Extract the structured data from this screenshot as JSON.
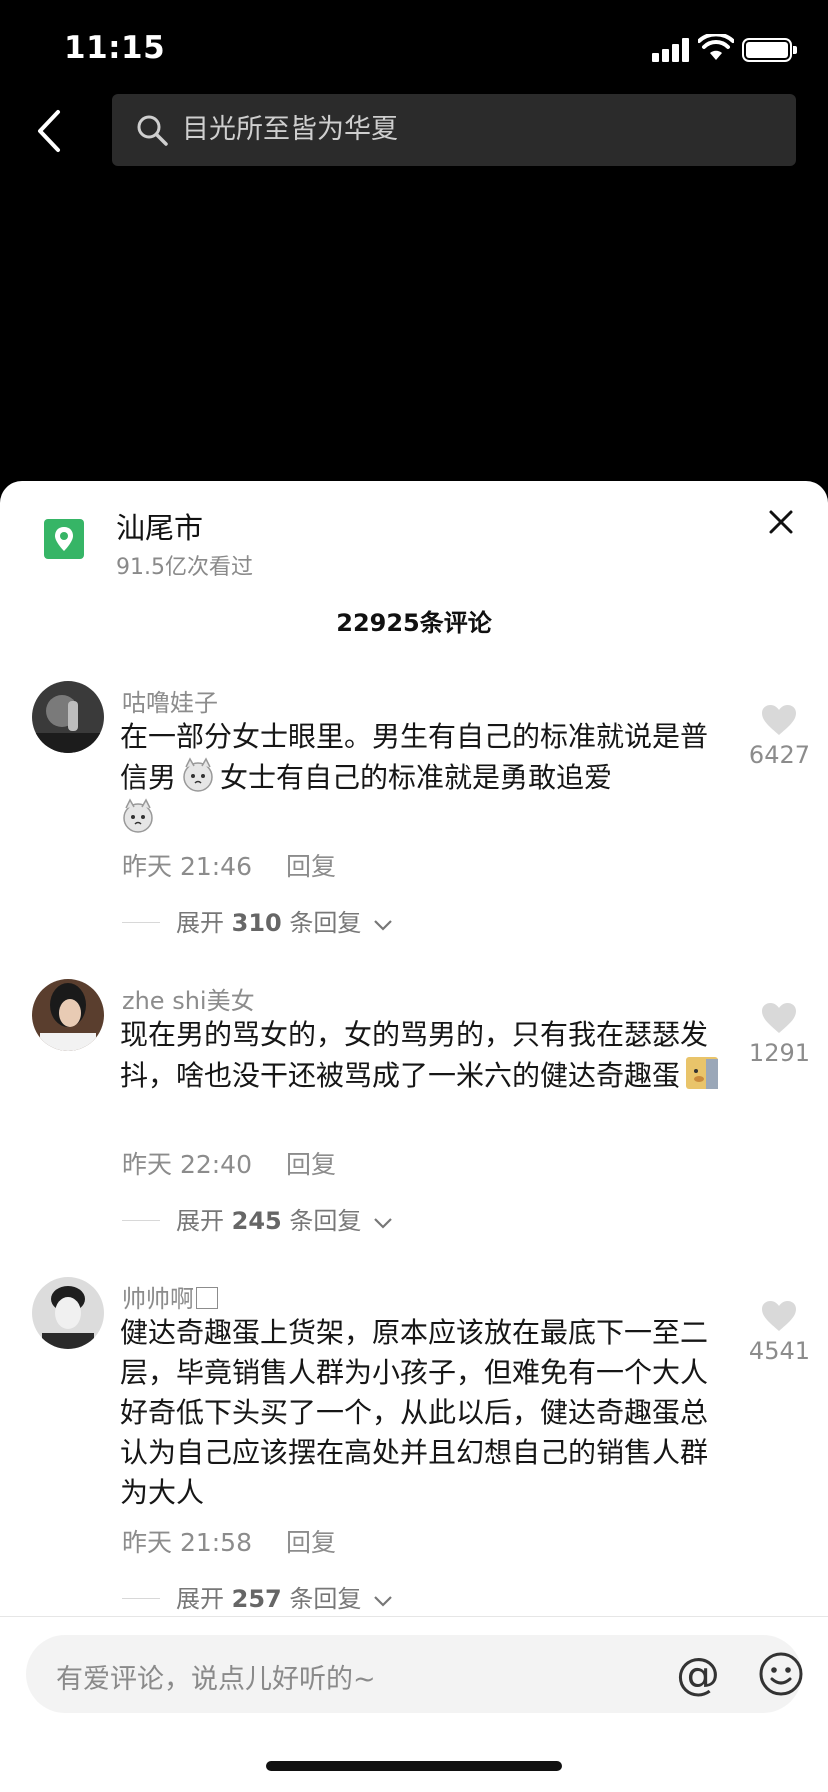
{
  "status_bar": {
    "time": "11:15"
  },
  "header": {
    "search_text": "目光所至皆为华夏"
  },
  "location": {
    "title": "汕尾市",
    "views": "91.5亿次看过"
  },
  "comment_count": "22925条评论",
  "comments": [
    {
      "user": "咕噜娃子",
      "text_a": "在一部分女士眼里。男生有自己的标准就说是普信男",
      "text_b": "女士有自己的标准就是勇敢追爱",
      "time": "昨天 21:46",
      "reply": "回复",
      "likes": "6427",
      "expand_pre": "展开",
      "expand_num": "310",
      "expand_post": "条回复"
    },
    {
      "user": "zhe shi美女",
      "text_a": "现在男的骂女的，女的骂男的，只有我在瑟瑟发抖，啥也没干还被骂成了一米六的健达奇趣蛋",
      "time": "昨天 22:40",
      "reply": "回复",
      "likes": "1291",
      "expand_pre": "展开",
      "expand_num": "245",
      "expand_post": "条回复"
    },
    {
      "user": "帅帅啊",
      "text_a": "健达奇趣蛋上货架，原本应该放在最底下一至二层，毕竟销售人群为小孩子，但难免有一个大人好奇低下头买了一个，从此以后，健达奇趣蛋总认为自己应该摆在高处并且幻想自己的销售人群为大人",
      "time": "昨天 21:58",
      "reply": "回复",
      "likes": "4541",
      "expand_pre": "展开",
      "expand_num": "257",
      "expand_post": "条回复"
    }
  ],
  "input": {
    "placeholder": "有爱评论，说点儿好听的~",
    "at_symbol": "@"
  },
  "icons": [
    "back-arrow-icon",
    "search-icon",
    "location-pin-icon",
    "close-icon",
    "heart-icon",
    "chevron-down-icon",
    "smiley-icon",
    "cat-emoji-icon",
    "doge-emoji-icon"
  ],
  "colors": {
    "accent_green": "#36b566",
    "dark_bg": "#000000",
    "search_bg": "#2b2b2b"
  }
}
